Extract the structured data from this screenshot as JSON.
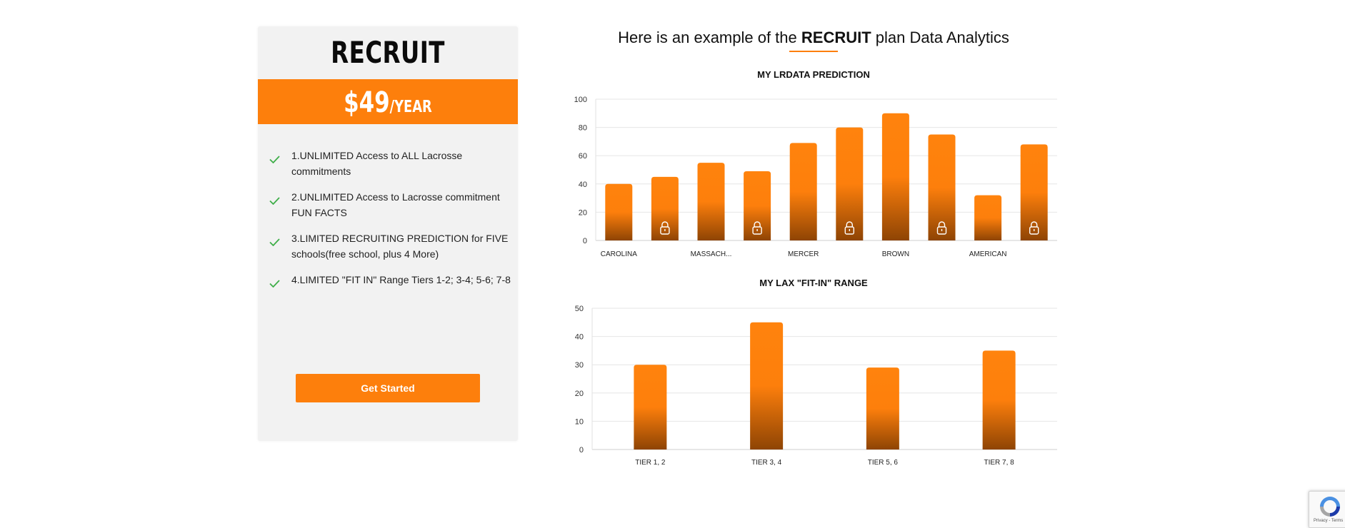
{
  "plan": {
    "title": "RECRUIT",
    "price": "$49",
    "period": "/YEAR",
    "features": [
      "1.UNLIMITED Access to ALL Lacrosse commitments",
      "2.UNLIMITED Access to Lacrosse commitment FUN FACTS",
      "3.LIMITED RECRUITING PREDICTION for FIVE schools(free school, plus 4 More)",
      "4.LIMITED \"FIT IN\" Range Tiers 1-2; 3-4; 5-6; 7-8"
    ],
    "cta_label": "Get Started",
    "check_icon": "check-icon"
  },
  "analytics": {
    "heading_prefix": "Here is an example of the ",
    "heading_bold": "RECRUIT",
    "heading_suffix": " plan Data Analytics"
  },
  "colors": {
    "accent": "#fd7f0c",
    "bar_top": "#ff830d",
    "bar_bottom": "#8e4404",
    "card_bg": "#f2f2f2",
    "check_green": "#3fae49"
  },
  "chart_data": [
    {
      "type": "bar",
      "title": "MY LRDATA PREDICTION",
      "categories": [
        "CAROLINA",
        "",
        "MASSACH...",
        "",
        "MERCER",
        "",
        "BROWN",
        "",
        "AMERICAN",
        ""
      ],
      "values": [
        40,
        45,
        55,
        49,
        69,
        80,
        90,
        75,
        32,
        68
      ],
      "locked": [
        false,
        true,
        false,
        true,
        false,
        true,
        false,
        true,
        false,
        true
      ],
      "ylim": [
        0,
        100
      ],
      "yticks": [
        0,
        20,
        40,
        60,
        80,
        100
      ],
      "grid": true
    },
    {
      "type": "bar",
      "title": "MY LAX \"FIT-IN\" RANGE",
      "categories": [
        "TIER 1, 2",
        "TIER 3, 4",
        "TIER 5, 6",
        "TIER 7, 8"
      ],
      "values": [
        30,
        45,
        29,
        35
      ],
      "ylim": [
        0,
        50
      ],
      "yticks": [
        0,
        10,
        20,
        30,
        40,
        50
      ],
      "grid": true
    }
  ],
  "recaptcha": {
    "text": "Privacy - Terms"
  }
}
